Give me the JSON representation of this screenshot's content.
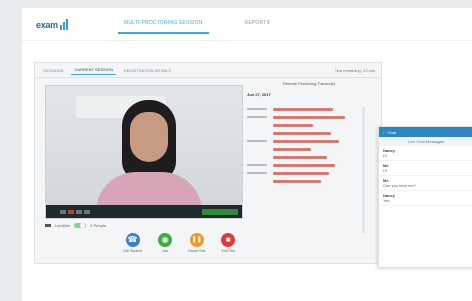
{
  "header": {
    "logo_text": "exam",
    "tabs": [
      {
        "label": "MULTI-PROCTORING SESSION",
        "active": true
      },
      {
        "label": "REPORTS",
        "active": false
      }
    ]
  },
  "panel": {
    "subtabs": [
      {
        "label": "Sessions",
        "active": false
      },
      {
        "label": "CURRENT SESSION",
        "active": true
      },
      {
        "label": "REGISTRATION DETAILS",
        "active": false
      }
    ],
    "status_text": "Test remaining: 23 min"
  },
  "controls": {
    "toggle_left_label": "Landline",
    "toggle_right_label": "2 People"
  },
  "actions": [
    {
      "label": "Call Student",
      "icon": "phone-icon",
      "symbol": "☎",
      "color": "#3b7fd0"
    },
    {
      "label": "Join",
      "icon": "join-icon",
      "symbol": "◉",
      "color": "#3fae3f"
    },
    {
      "label": "Pause Test",
      "icon": "pause-icon",
      "symbol": "❚❚",
      "color": "#f09a2c"
    },
    {
      "label": "End Test",
      "icon": "stop-icon",
      "symbol": "■",
      "color": "#e23a3a"
    }
  ],
  "transcript": {
    "title": "Remote Proctoring Transcript",
    "date_label": "Jun 27, 2017"
  },
  "chat": {
    "header_title": "Chat",
    "sub_title": "Live Chat Messages",
    "messages": [
      {
        "name": "Nancy",
        "text": "Hi"
      },
      {
        "name": "Me",
        "text": "Hi"
      },
      {
        "name": "Me",
        "text": "Can you hear me?"
      },
      {
        "name": "Nancy",
        "text": "Yes"
      }
    ]
  }
}
